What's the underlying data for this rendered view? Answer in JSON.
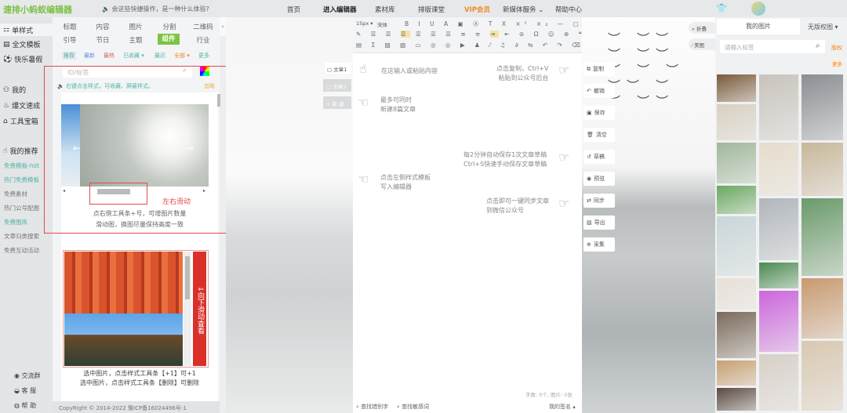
{
  "header": {
    "logo": "速排小蚂蚁编辑器",
    "notice": "会这些快捷操作，是一种什么体验?",
    "nav": [
      "首页",
      "进入编辑器",
      "素材库",
      "排版课堂",
      "VIP会员",
      "新媒体服务 ⌄",
      "帮助中心"
    ]
  },
  "sidebar": {
    "main": [
      {
        "icon": "grid-icon",
        "label": "单样式"
      },
      {
        "icon": "template-icon",
        "label": "全文模板"
      },
      {
        "icon": "ball-icon",
        "label": "快乐暑假"
      },
      {
        "icon": "user-icon",
        "label": "我的"
      },
      {
        "icon": "fire-icon",
        "label": "爆文速成"
      },
      {
        "icon": "toolbox-icon",
        "label": "工具宝箱"
      },
      {
        "icon": "thumb-icon",
        "label": "我的推荐"
      }
    ],
    "links": [
      "免费模板-hot",
      "热门免费模板",
      "免费素材",
      "热门公号配图",
      "免费图库",
      "文章归类搜索",
      "免费互动活动"
    ],
    "bottom": [
      "交流群",
      "客 服",
      "帮 助"
    ]
  },
  "panel": {
    "categories": [
      "标题",
      "内容",
      "图片",
      "分割",
      "二维码",
      "引导",
      "节日",
      "主题",
      "组件",
      "行业"
    ],
    "filters": [
      "推荐",
      "最新",
      "最热",
      "已收藏 ▾",
      "最近",
      "全部 ▾",
      "更多"
    ],
    "search_placeholder": "ID/标签",
    "hint": "右键点击样式，可收藏、屏蔽样式。",
    "ignore": "忽略",
    "slide_label": "左右滑动",
    "slide_desc1": "点右侧工具条+号，可增图片数量",
    "slide_desc2": "滑动图，换图尽量保持高度一致",
    "scroll_label": "向下滑动查看",
    "scroll_desc1": "选中图片，点击样式工具条【+1】可+1",
    "scroll_desc2": "选中图片，点击样式工具条【删除】可删除",
    "copyright": "CopyRight © 2014-2022 豫ICP备16024496号-1"
  },
  "docs": {
    "items": [
      "文章1",
      "文章2"
    ],
    "new": "+ 新 建"
  },
  "editor": {
    "font_size": "15px ▾",
    "font": "宋体",
    "tips": [
      [
        "在这输入或粘贴内容"
      ],
      [
        "点击复制，Ctrl+V",
        "粘贴到公众号后台"
      ],
      [
        "最多可同时",
        "新建8篇文章"
      ],
      [
        "每2分钟自动保存1次文章草稿",
        "Ctrl+S快速手动保存文章草稿"
      ],
      [
        "点击左侧样式模板",
        "写入编辑器"
      ],
      [
        "点击即可一键同步文章",
        "到微信公众号"
      ]
    ],
    "stats": "字数: 0个, 图片: 0张",
    "find_typo": "查找错别字",
    "find_sensitive": "查找敏感词",
    "signature": "我的签名 ▴"
  },
  "actions": [
    "复制",
    "撤销",
    "保存",
    "清空",
    "草稿",
    "预览",
    "同步",
    "导出",
    "采集"
  ],
  "float": {
    "collapse": "» 折叠",
    "beautify": "美图"
  },
  "images": {
    "tab_mine": "我的图片",
    "tab_free": "无版权图 ▾",
    "search_placeholder": "请输入标签",
    "copyright": "版权",
    "more": "更多"
  }
}
